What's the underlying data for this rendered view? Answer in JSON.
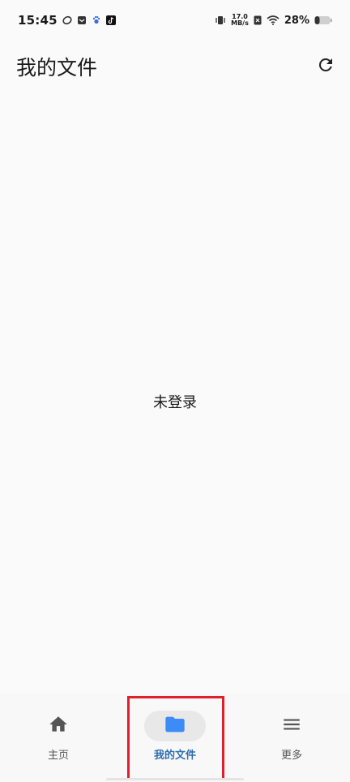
{
  "status_bar": {
    "time": "15:45",
    "net_speed_value": "17.0",
    "net_speed_unit": "MB/s",
    "battery_percent": "28%",
    "icons": [
      "sync-icon",
      "mail-icon",
      "baidu-icon",
      "tiktok-icon",
      "vibrate-icon",
      "no-sim-icon",
      "wifi-icon",
      "battery-icon"
    ]
  },
  "header": {
    "title": "我的文件",
    "refresh_icon": "refresh-icon"
  },
  "main": {
    "message": "未登录"
  },
  "bottom_nav": {
    "items": [
      {
        "label": "主页",
        "icon": "home-icon",
        "active": false
      },
      {
        "label": "我的文件",
        "icon": "folder-icon",
        "active": true
      },
      {
        "label": "更多",
        "icon": "menu-icon",
        "active": false
      }
    ]
  },
  "colors": {
    "background": "#fafafa",
    "active_label": "#2f6fb0",
    "folder_icon": "#3d8bf5",
    "highlight": "#e0202a"
  }
}
